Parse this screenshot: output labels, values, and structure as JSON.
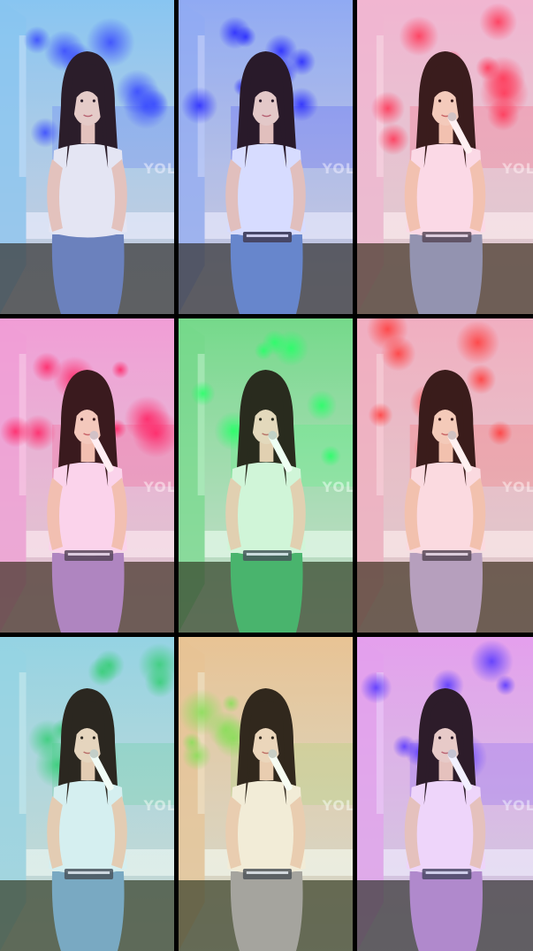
{
  "grid": {
    "rows": 3,
    "columns": 3,
    "background": "#000000"
  },
  "wall_text": "YOL",
  "tiles": [
    {
      "tint": "#8fd0f0",
      "accent": "#3a4cff",
      "shirt": "#f2f2f2",
      "pants": "#6f86b8",
      "prop": "none"
    },
    {
      "tint": "#9ab6f2",
      "accent": "#2a2cff",
      "shirt": "#e6ecff",
      "pants": "#6d8fc8",
      "prop": "keyboard"
    },
    {
      "tint": "#f0c0dc",
      "accent": "#ff3a5a",
      "shirt": "#fbe6f2",
      "pants": "#8a9bb8",
      "prop": "mic"
    },
    {
      "tint": "#f0a8e0",
      "accent": "#ff2a6a",
      "shirt": "#fbe2f7",
      "pants": "#a98ec8",
      "prop": "mic"
    },
    {
      "tint": "#7cd68e",
      "accent": "#2aff6a",
      "shirt": "#dff5e2",
      "pants": "#4cae6e",
      "prop": "mic"
    },
    {
      "tint": "#f0b8cc",
      "accent": "#ff4040",
      "shirt": "#fbe8ee",
      "pants": "#b0a8c8",
      "prop": "mic"
    },
    {
      "tint": "#9cd4ec",
      "accent": "#3acf7a",
      "shirt": "#e2f2fa",
      "pants": "#7ea6c8",
      "prop": "mic"
    },
    {
      "tint": "#f0c29a",
      "accent": "#8adf5a",
      "shirt": "#fbeee2",
      "pants": "#a8a0a4",
      "prop": "mic"
    },
    {
      "tint": "#f0a8ec",
      "accent": "#5a3aff",
      "shirt": "#fbe2fa",
      "pants": "#b890c8",
      "prop": "mic"
    }
  ]
}
